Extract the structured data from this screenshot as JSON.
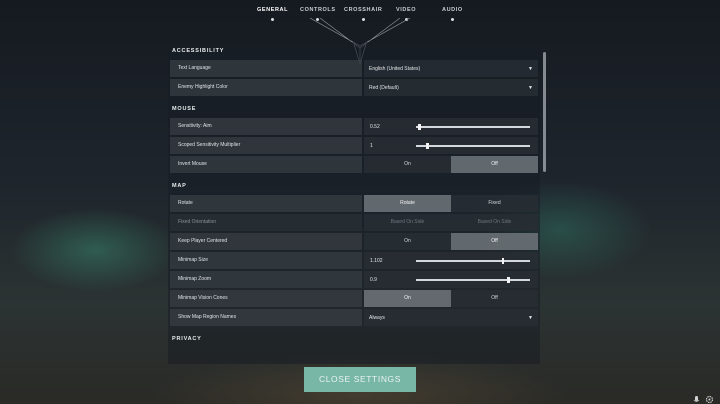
{
  "nav": {
    "tabs": [
      {
        "label": "GENERAL",
        "active": true
      },
      {
        "label": "CONTROLS",
        "active": false
      },
      {
        "label": "CROSSHAIR",
        "active": false
      },
      {
        "label": "VIDEO",
        "active": false
      },
      {
        "label": "AUDIO",
        "active": false
      }
    ]
  },
  "sections": {
    "accessibility": {
      "title": "ACCESSIBILITY",
      "text_language": {
        "label": "Text Language",
        "value": "English (United States)"
      },
      "enemy_highlight": {
        "label": "Enemy Highlight Color",
        "value": "Red (Default)"
      }
    },
    "mouse": {
      "title": "MOUSE",
      "sensitivity_aim": {
        "label": "Sensitivity: Aim",
        "value": "0.52",
        "fill": 0.02
      },
      "scoped_multiplier": {
        "label": "Scoped Sensitivity Multiplier",
        "value": "1",
        "fill": 0.09
      },
      "invert_mouse": {
        "label": "Invert Mouse",
        "on": "On",
        "off": "Off",
        "selected": "Off"
      }
    },
    "map": {
      "title": "MAP",
      "rotate": {
        "label": "Rotate",
        "opt1": "Rotate",
        "opt2": "Fixed",
        "selected": "Rotate"
      },
      "fixed_orientation": {
        "label": "Fixed Orientation",
        "opt1": "Based On Side",
        "opt2": "Based On Side",
        "disabled": true
      },
      "keep_player_centered": {
        "label": "Keep Player Centered",
        "on": "On",
        "off": "Off",
        "selected": "Off"
      },
      "minimap_size": {
        "label": "Minimap Size",
        "value": "1.102",
        "fill": 0.75
      },
      "minimap_zoom": {
        "label": "Minimap Zoom",
        "value": "0.9",
        "fill": 0.8
      },
      "minimap_vision_cones": {
        "label": "Minimap Vision Cones",
        "on": "On",
        "off": "Off",
        "selected": "On"
      },
      "show_region_names": {
        "label": "Show Map Region Names",
        "value": "Always"
      }
    },
    "privacy": {
      "title": "PRIVACY"
    }
  },
  "footer": {
    "close_label": "CLOSE SETTINGS"
  },
  "colors": {
    "accent": "#78b6a6"
  },
  "icons": [
    "mic-icon",
    "settings-icon"
  ]
}
